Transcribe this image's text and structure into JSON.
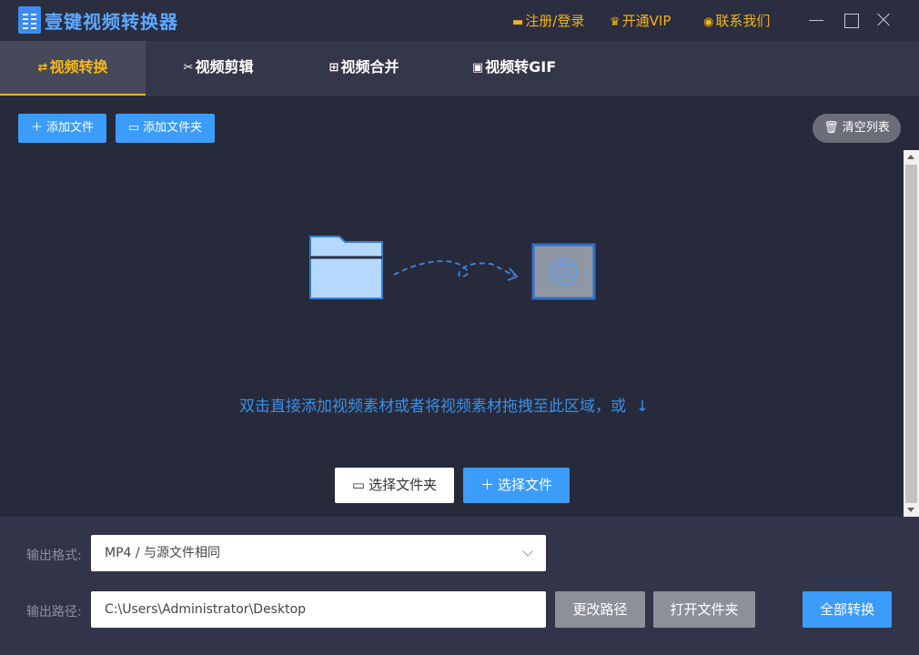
{
  "app": {
    "title": "壹键视频转换器"
  },
  "titlebar": {
    "login": "注册/登录",
    "vip": "开通VIP",
    "contact": "联系我们"
  },
  "tabs": [
    {
      "label": "视频转换",
      "active": true
    },
    {
      "label": "视频剪辑",
      "active": false
    },
    {
      "label": "视频合并",
      "active": false
    },
    {
      "label": "视频转GIF",
      "active": false
    }
  ],
  "toolbar": {
    "add_file": "添加文件",
    "add_folder": "添加文件夹",
    "clear_list": "清空列表"
  },
  "dropzone": {
    "hint": "双击直接添加视频素材或者将视频素材拖拽至此区域，或",
    "select_folder": "选择文件夹",
    "select_file": "选择文件"
  },
  "output": {
    "format_label": "输出格式:",
    "format_value": "MP4 / 与源文件相同",
    "path_label": "输出路径:",
    "path_value": "C:\\Users\\Administrator\\Desktop",
    "change_path": "更改路径",
    "open_folder": "打开文件夹",
    "convert_all": "全部转换"
  },
  "colors": {
    "accent": "#3c9cfa",
    "active_tab": "#f7b81b",
    "link": "#f2b318",
    "background": "#272a3a"
  }
}
